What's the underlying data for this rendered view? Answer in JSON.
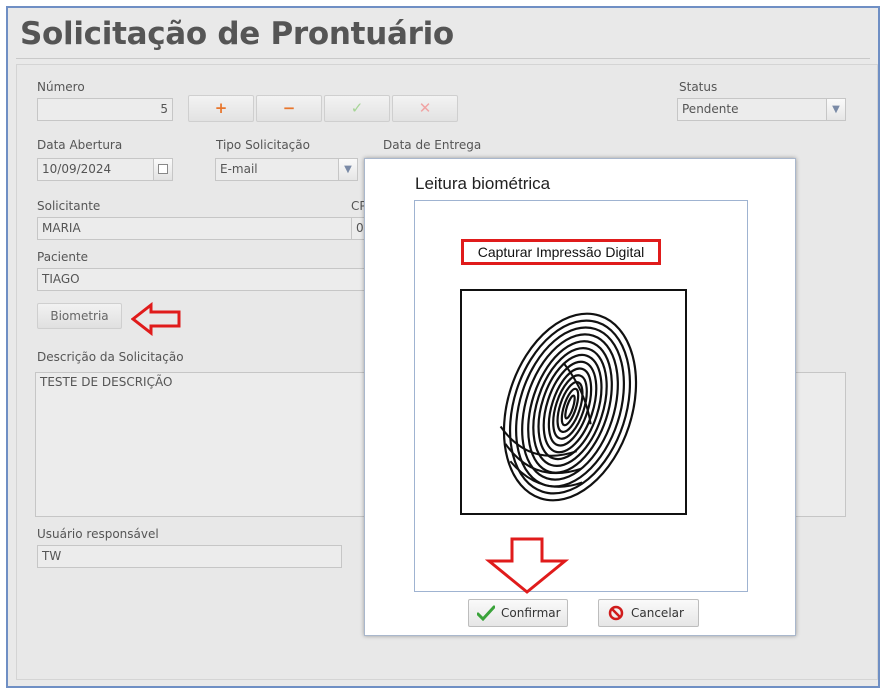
{
  "page": {
    "title": "Solicitação de Prontuário"
  },
  "form": {
    "numero": {
      "label": "Número",
      "value": "5"
    },
    "toolbar": {
      "add": "+",
      "remove": "−",
      "confirm": "✓",
      "cancel": "✕"
    },
    "status": {
      "label": "Status",
      "value": "Pendente"
    },
    "data_abertura": {
      "label": "Data Abertura",
      "value": "10/09/2024"
    },
    "tipo_solicitacao": {
      "label": "Tipo Solicitação",
      "value": "E-mail"
    },
    "data_entrega": {
      "label": "Data de Entrega",
      "value": ""
    },
    "solicitante": {
      "label": "Solicitante",
      "value": "MARIA"
    },
    "cpf": {
      "label": "CP",
      "value": "0"
    },
    "paciente": {
      "label": "Paciente",
      "value": "TIAGO"
    },
    "biometria_button": "Biometria",
    "descricao": {
      "label": "Descrição da Solicitação",
      "value": "TESTE DE DESCRIÇÃO"
    },
    "usuario": {
      "label": "Usuário responsável",
      "value": "TW"
    }
  },
  "modal": {
    "title": "Leitura biométrica",
    "capture_label": "Capturar Impressão Digital",
    "confirm_label": "Confirmar",
    "cancel_label": "Cancelar"
  },
  "colors": {
    "accent_red": "#e01b1b",
    "frame_blue": "#6f8fc4",
    "plus_orange": "#e8762d",
    "check_green": "#9bcf8a"
  },
  "icons": [
    "calendar-icon",
    "chevron-down-icon",
    "fingerprint-icon",
    "check-icon",
    "prohibited-icon",
    "arrow-left-icon",
    "arrow-down-icon"
  ]
}
